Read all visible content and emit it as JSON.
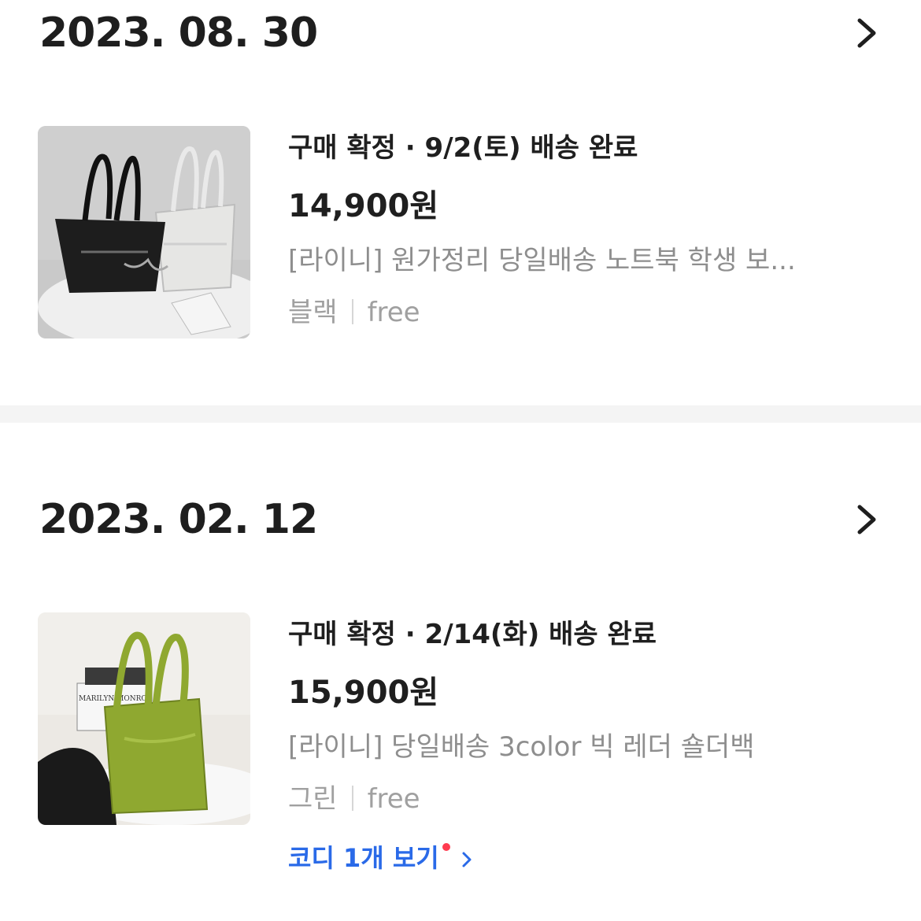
{
  "orders": [
    {
      "date": "2023. 08. 30",
      "status": "구매 확정 · 9/2(토) 배송 완료",
      "price": "14,900원",
      "product_name": "[라이니] 원가정리 당일배송 노트북 학생 보...",
      "option_color": "블랙",
      "option_size": "free",
      "thumbnail_icon": "black-white-tote-bags-photo"
    },
    {
      "date": "2023. 02. 12",
      "status": "구매 확정 · 2/14(화) 배송 완료",
      "price": "15,900원",
      "product_name": "[라이니] 당일배송 3color 빅 레더 숄더백",
      "option_color": "그린",
      "option_size": "free",
      "thumbnail_icon": "green-leather-shoulder-bag-photo",
      "thumbnail_magazine_text": "MARILYN MONROE",
      "coordi_link": "코디 1개 보기"
    }
  ],
  "icons": {
    "chevron": "chevron-right-icon",
    "notification_dot": "red-dot-badge"
  },
  "colors": {
    "link_blue": "#2a6ae8",
    "badge_red": "#ff3b4f",
    "separator": "#f4f4f4",
    "muted_text": "#8e8e8e"
  }
}
